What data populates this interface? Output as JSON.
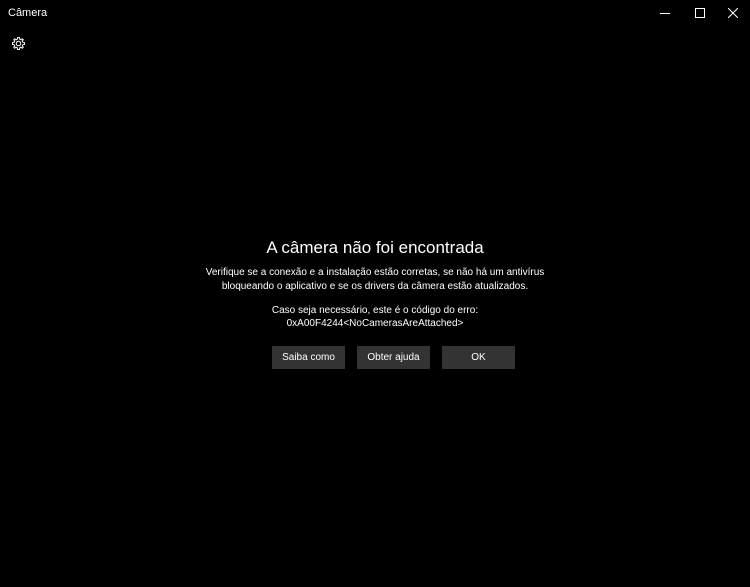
{
  "window": {
    "title": "Câmera"
  },
  "icons": {
    "minimize": "minimize-icon",
    "maximize": "maximize-icon",
    "close": "close-icon",
    "settings": "gear-icon"
  },
  "error": {
    "heading": "A câmera não foi encontrada",
    "description_line1": "Verifique se a conexão e a instalação estão corretas, se não há um antivírus",
    "description_line2": "bloqueando o aplicativo e se os drivers da câmera estão atualizados.",
    "code_intro": "Caso seja necessário, este é o código do erro:",
    "code": "0xA00F4244<NoCamerasAreAttached>"
  },
  "buttons": {
    "learn_more": "Saiba como",
    "get_help": "Obter ajuda",
    "ok": "OK"
  },
  "colors": {
    "background": "#000000",
    "text": "#ffffff",
    "button": "#333333"
  }
}
